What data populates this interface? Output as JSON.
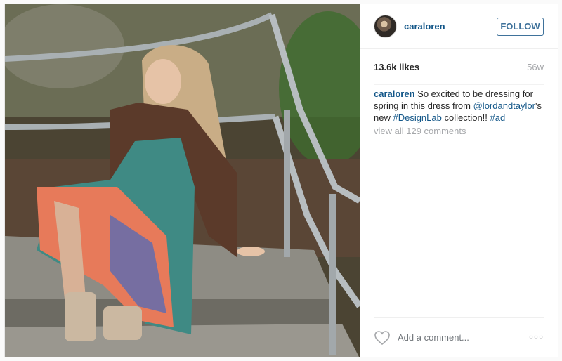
{
  "post": {
    "username": "caraloren",
    "follow_label": "FOLLOW",
    "likes": "13.6k likes",
    "time": "56w",
    "caption": {
      "username": "caraloren",
      "text_1": " So excited to be dressing for spring in this dress from ",
      "mention": "@lordandtaylor",
      "text_2": "'s new ",
      "hashtag_1": "#DesignLab",
      "text_3": " collection!! ",
      "hashtag_2": "#ad"
    },
    "view_comments": "view all 129 comments",
    "comment_placeholder": "Add a comment...",
    "more_glyph": "○○○"
  },
  "icons": {
    "like": "heart-outline-icon",
    "more": "more-options-icon"
  },
  "colors": {
    "link": "#125688",
    "follow": "#3f729b",
    "muted": "#a5a7aa",
    "text": "#262626"
  }
}
